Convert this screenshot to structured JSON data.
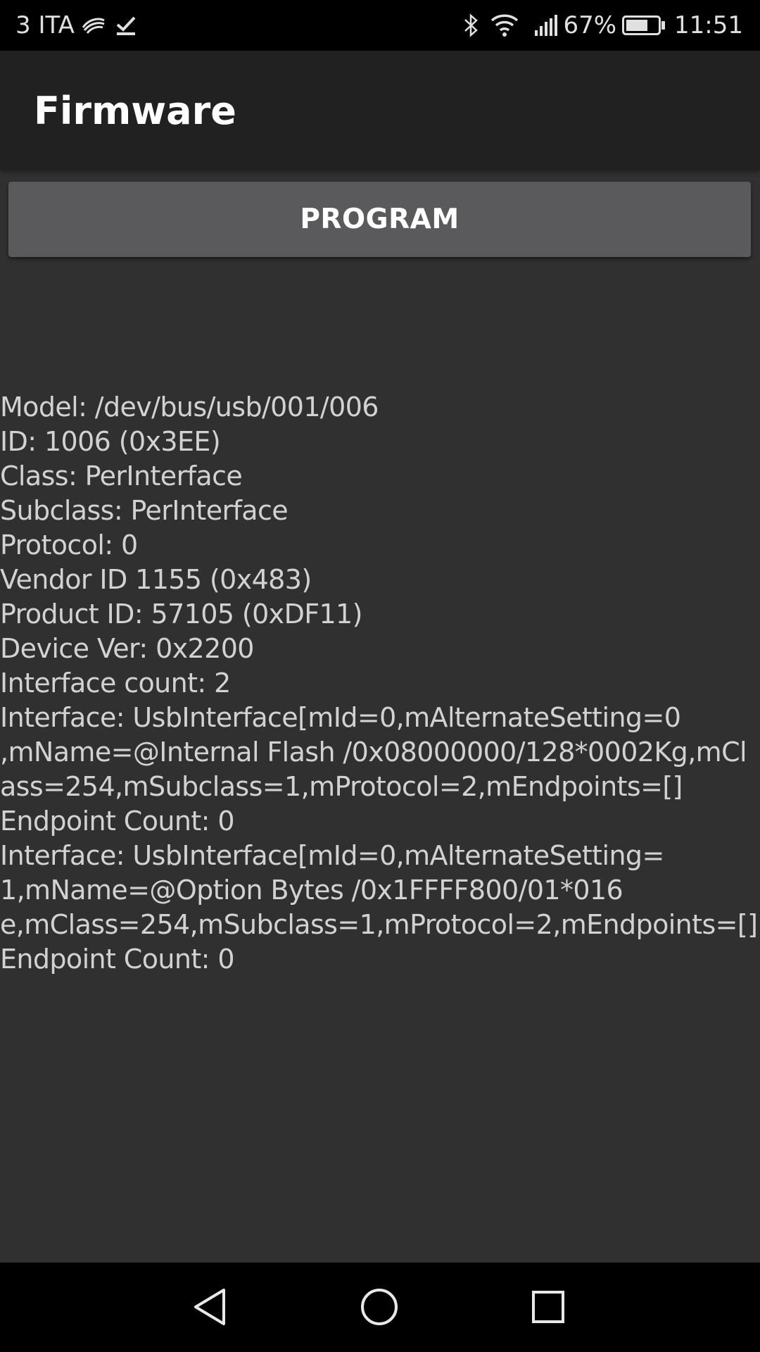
{
  "status_bar": {
    "carrier": "3 ITA",
    "battery_percent": "67%",
    "time": "11:51",
    "icons": [
      "carrier-swoosh-icon",
      "checkmark-download-icon",
      "bluetooth-icon",
      "wifi-icon",
      "signal-icon",
      "battery-icon"
    ]
  },
  "toolbar": {
    "title": "Firmware"
  },
  "actions": {
    "program_label": "PROGRAM"
  },
  "device_info": {
    "lines": [
      "Model: /dev/bus/usb/001/006",
      "ID: 1006 (0x3EE)",
      "Class: PerInterface",
      "Subclass: PerInterface",
      "Protocol: 0",
      "Vendor ID 1155 (0x483)",
      "Product ID: 57105 (0xDF11)",
      "Device Ver: 0x2200",
      "Interface count: 2",
      "Interface: UsbInterface[mId=0,mAlternateSetting=0",
      ",mName=@Internal Flash  /0x08000000/128*0002Kg,mCl",
      "ass=254,mSubclass=1,mProtocol=2,mEndpoints=[]",
      "Endpoint Count: 0",
      "Interface: UsbInterface[mId=0,mAlternateSetting=",
      "1,mName=@Option Bytes  /0x1FFFF800/01*016",
      "e,mClass=254,mSubclass=1,mProtocol=2,mEndpoints=[]",
      "Endpoint Count: 0"
    ]
  },
  "nav_bar": {
    "buttons": [
      "back-icon",
      "home-icon",
      "recents-icon"
    ]
  },
  "colors": {
    "background": "#303030",
    "toolbar": "#212121",
    "button": "#5a5a5c",
    "text": "#d2d2d2"
  }
}
